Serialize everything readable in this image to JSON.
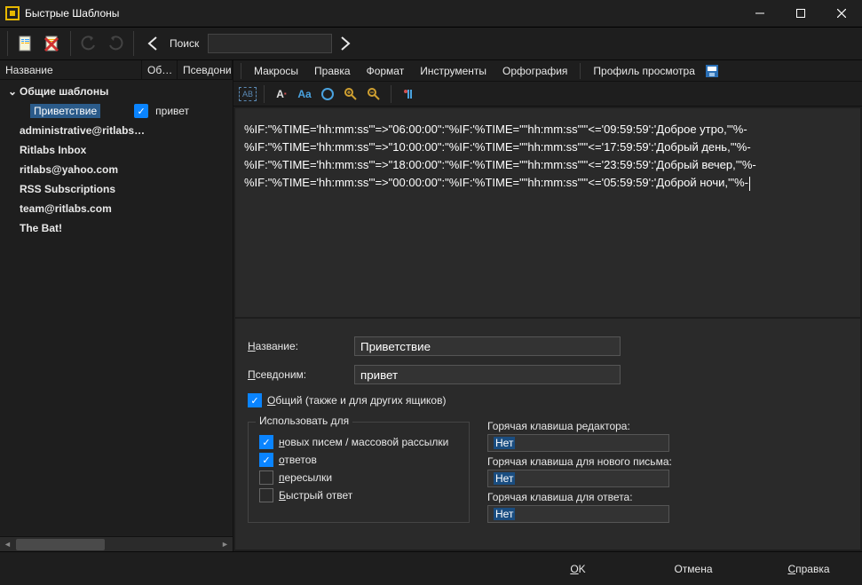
{
  "window": {
    "title": "Быстрые Шаблоны"
  },
  "toolbar": {
    "search_label": "Поиск",
    "search_value": ""
  },
  "left": {
    "cols": {
      "name": "Название",
      "shared": "Об…",
      "alias": "Псевдони…"
    },
    "root": "Общие шаблоны",
    "selected": {
      "label": "Приветствие",
      "alias": "привет"
    },
    "items": [
      "administrative@ritlabs…",
      "Ritlabs Inbox",
      "ritlabs@yahoo.com",
      "RSS Subscriptions",
      "team@ritlabs.com",
      "The Bat!"
    ]
  },
  "menubar": {
    "macros": "Макросы",
    "edit": "Правка",
    "format": "Формат",
    "tools": "Инструменты",
    "spell": "Орфография",
    "profile": "Профиль просмотра"
  },
  "editor": {
    "l1": "%IF:\"%TIME='hh:mm:ss'\"=>\"06:00:00\":\"%IF:'%TIME=\"\"hh:mm:ss\"\"'<='09:59:59':'Доброе утро,'\"%-",
    "l2": "%IF:\"%TIME='hh:mm:ss'\"=>\"10:00:00\":\"%IF:'%TIME=\"\"hh:mm:ss\"\"'<='17:59:59':'Добрый день,'\"%-",
    "l3": "%IF:\"%TIME='hh:mm:ss'\"=>\"18:00:00\":\"%IF:'%TIME=\"\"hh:mm:ss\"\"'<='23:59:59':'Добрый вечер,'\"%-",
    "l4": "%IF:\"%TIME='hh:mm:ss'\"=>\"00:00:00\":\"%IF:'%TIME=\"\"hh:mm:ss\"\"'<='05:59:59':'Доброй ночи,'\"%-"
  },
  "form": {
    "name_label_pre": "Н",
    "name_label_rest": "азвание:",
    "alias_label_pre": "П",
    "alias_label_rest": "севдоним:",
    "name_value": "Приветствие",
    "alias_value": "привет",
    "shared_pre": "О",
    "shared_rest": "бщий (также и для других ящиков)",
    "usefor_label": "Использовать для",
    "usefor_new_pre": "н",
    "usefor_new_rest": "овых писем / массовой рассылки",
    "usefor_reply_pre": "о",
    "usefor_reply_rest": "тветов",
    "usefor_fwd_pre": "п",
    "usefor_fwd_rest": "ересылки",
    "usefor_quick_pre": "Б",
    "usefor_quick_rest": "ыстрый ответ",
    "hk_editor_label": "Горячая клавиша редактора:",
    "hk_new_label": "Горячая клавиша для нового письма:",
    "hk_reply_label": "Горячая клавиша для ответа:",
    "hk_none": "Нет"
  },
  "buttons": {
    "ok_pre": "O",
    "ok_rest": "K",
    "cancel": "Отмена",
    "help_pre": "С",
    "help_rest": "правка"
  }
}
